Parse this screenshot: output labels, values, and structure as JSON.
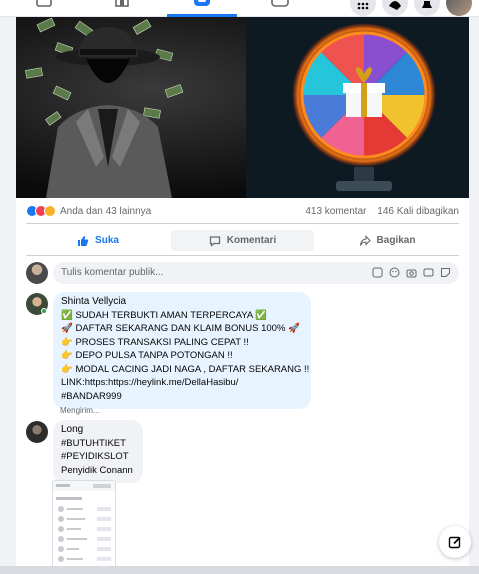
{
  "post": {
    "reactions_text": "Anda dan 43 lainnya",
    "comments_count": "413 komentar",
    "shares_count": "146 Kali dibagikan"
  },
  "actions": {
    "like": "Suka",
    "comment": "Komentari",
    "share": "Bagikan"
  },
  "comment_input": {
    "placeholder": "Tulis komentar publik..."
  },
  "comments": [
    {
      "author": "Shinta Vellycia",
      "lines": [
        "✅ SUDAH TERBUKTI AMAN TERPERCAYA ✅",
        "🚀 DAFTAR SEKARANG DAN KLAIM BONUS 100% 🚀",
        "👉 PROSES TRANSAKSI PALING CEPAT !!",
        "👉 DEPO PULSA TANPA POTONGAN !!",
        "👉 MODAL CACING JADI NAGA , DAFTAR SEKARANG !!",
        "LINK:https:https://heylink.me/DellaHasibu/",
        "#BANDAR999"
      ],
      "status": "Mengirim..."
    },
    {
      "author": "Long",
      "lines": [
        "#BUTUHTIKET",
        "#PEYIDIKSLOT",
        "Penyidik Conann"
      ]
    }
  ],
  "colors": {
    "accent": "#1877f2",
    "bubble_blue": "#e7f3ff",
    "bubble_grey": "#f0f2f5"
  }
}
